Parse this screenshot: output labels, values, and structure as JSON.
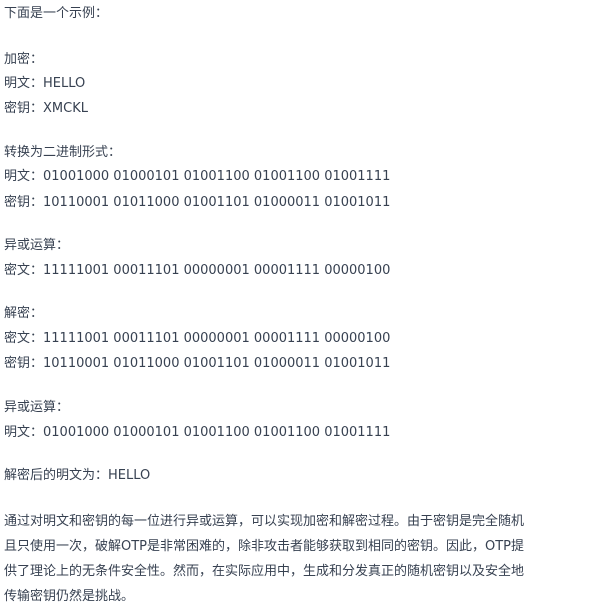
{
  "intro": "下面是一个示例：",
  "encryption": {
    "heading": "加密：",
    "plaintext": "明文：HELLO",
    "key": "密钥：XMCKL"
  },
  "binary": {
    "heading": "转换为二进制形式：",
    "plaintext": "明文：01001000 01000101 01001100 01001100 01001111",
    "key": "密钥：10110001 01011000 01001101 01000011 01001011"
  },
  "xor1": {
    "heading": "异或运算：",
    "ciphertext": "密文：11111001 00011101 00000001 00001111 00000100"
  },
  "decryption": {
    "heading": "解密：",
    "ciphertext": "密文：11111001 00011101 00000001 00001111 00000100",
    "key": "密钥：10110001 01011000 01001101 01000011 01001011"
  },
  "xor2": {
    "heading": "异或运算：",
    "plaintext": "明文：01001000 01000101 01001100 01001100 01001111"
  },
  "result": "解密后的明文为：HELLO",
  "summary_lines": [
    "通过对明文和密钥的每一位进行异或运算，可以实现加密和解密过程。由于密钥是完全随机",
    "且只使用一次，破解OTP是非常困难的，除非攻击者能够获取到相同的密钥。因此，OTP提",
    "供了理论上的无条件安全性。然而，在实际应用中，生成和分发真正的随机密钥以及安全地",
    "传输密钥仍然是挑战。"
  ]
}
